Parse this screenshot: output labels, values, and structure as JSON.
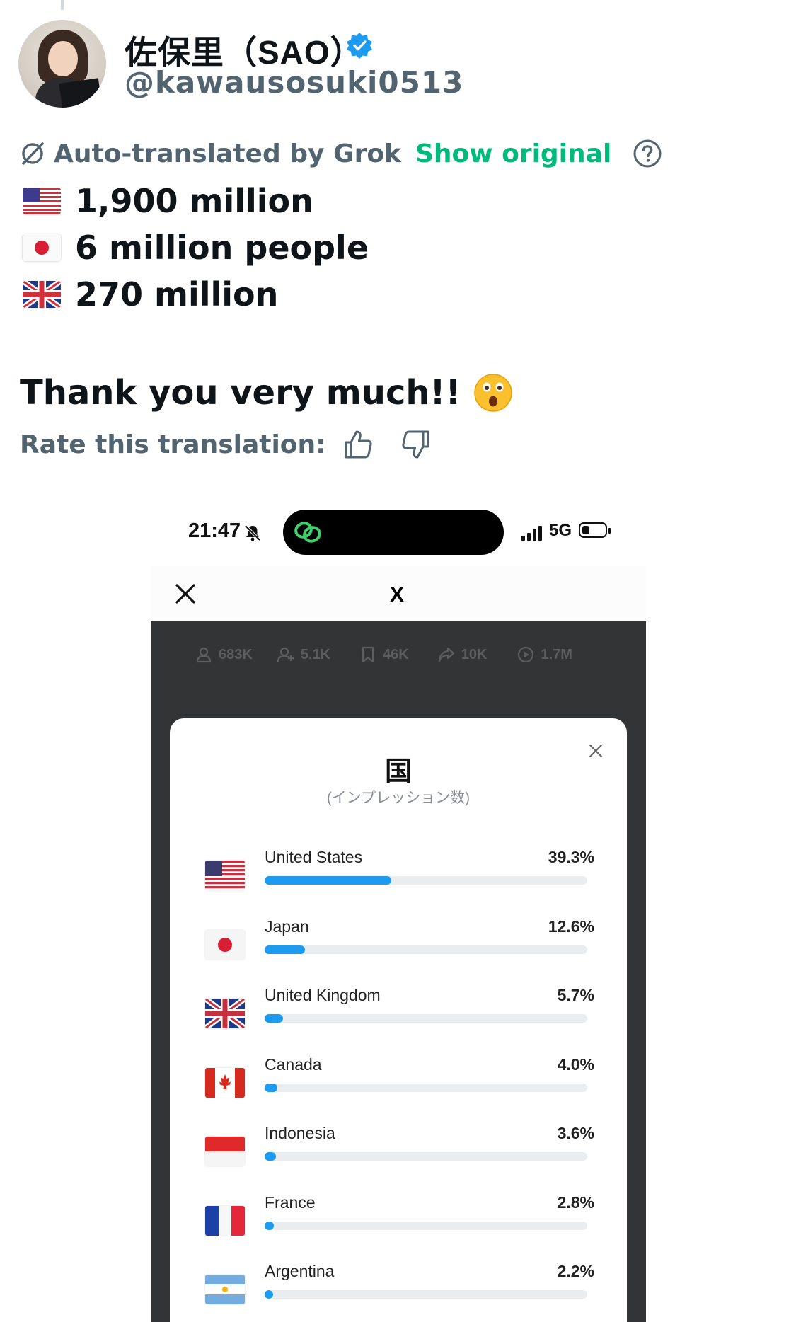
{
  "post": {
    "display_name": "佐保里（SAO）",
    "handle": "@kawausosuki0513",
    "translation_label": "Auto-translated by Grok",
    "show_original": "Show original",
    "stats": [
      {
        "flag": "us-flag-emoji",
        "text": "1,900 million"
      },
      {
        "flag": "jp-flag-emoji",
        "text": "6 million people"
      },
      {
        "flag": "uk-flag-emoji",
        "text": "270 million"
      }
    ],
    "thanks": "Thank you very much!!",
    "rate_label": "Rate this translation:"
  },
  "phone": {
    "time": "21:47",
    "network": "5G",
    "app_logo": "X",
    "metrics": [
      {
        "icon": "person-icon",
        "value": "683K"
      },
      {
        "icon": "add-person-icon",
        "value": "5.1K"
      },
      {
        "icon": "bookmark-icon",
        "value": "46K"
      },
      {
        "icon": "share-icon",
        "value": "10K"
      },
      {
        "icon": "play-icon",
        "value": "1.7M"
      }
    ],
    "modal": {
      "title": "国",
      "subtitle": "(インプレッション数)",
      "countries": [
        {
          "name": "United States",
          "percent": "39.3%",
          "value": 39.3,
          "flag": "us"
        },
        {
          "name": "Japan",
          "percent": "12.6%",
          "value": 12.6,
          "flag": "jp"
        },
        {
          "name": "United Kingdom",
          "percent": "5.7%",
          "value": 5.7,
          "flag": "uk"
        },
        {
          "name": "Canada",
          "percent": "4.0%",
          "value": 4.0,
          "flag": "ca"
        },
        {
          "name": "Indonesia",
          "percent": "3.6%",
          "value": 3.6,
          "flag": "id"
        },
        {
          "name": "France",
          "percent": "2.8%",
          "value": 2.8,
          "flag": "fr"
        },
        {
          "name": "Argentina",
          "percent": "2.2%",
          "value": 2.2,
          "flag": "ar"
        }
      ]
    }
  },
  "colors": {
    "accent_green": "#00ba7c",
    "bar_blue": "#1d9bf0",
    "verified_blue": "#1d9bf0",
    "muted_text": "#536471",
    "dark_panel": "#333435"
  }
}
